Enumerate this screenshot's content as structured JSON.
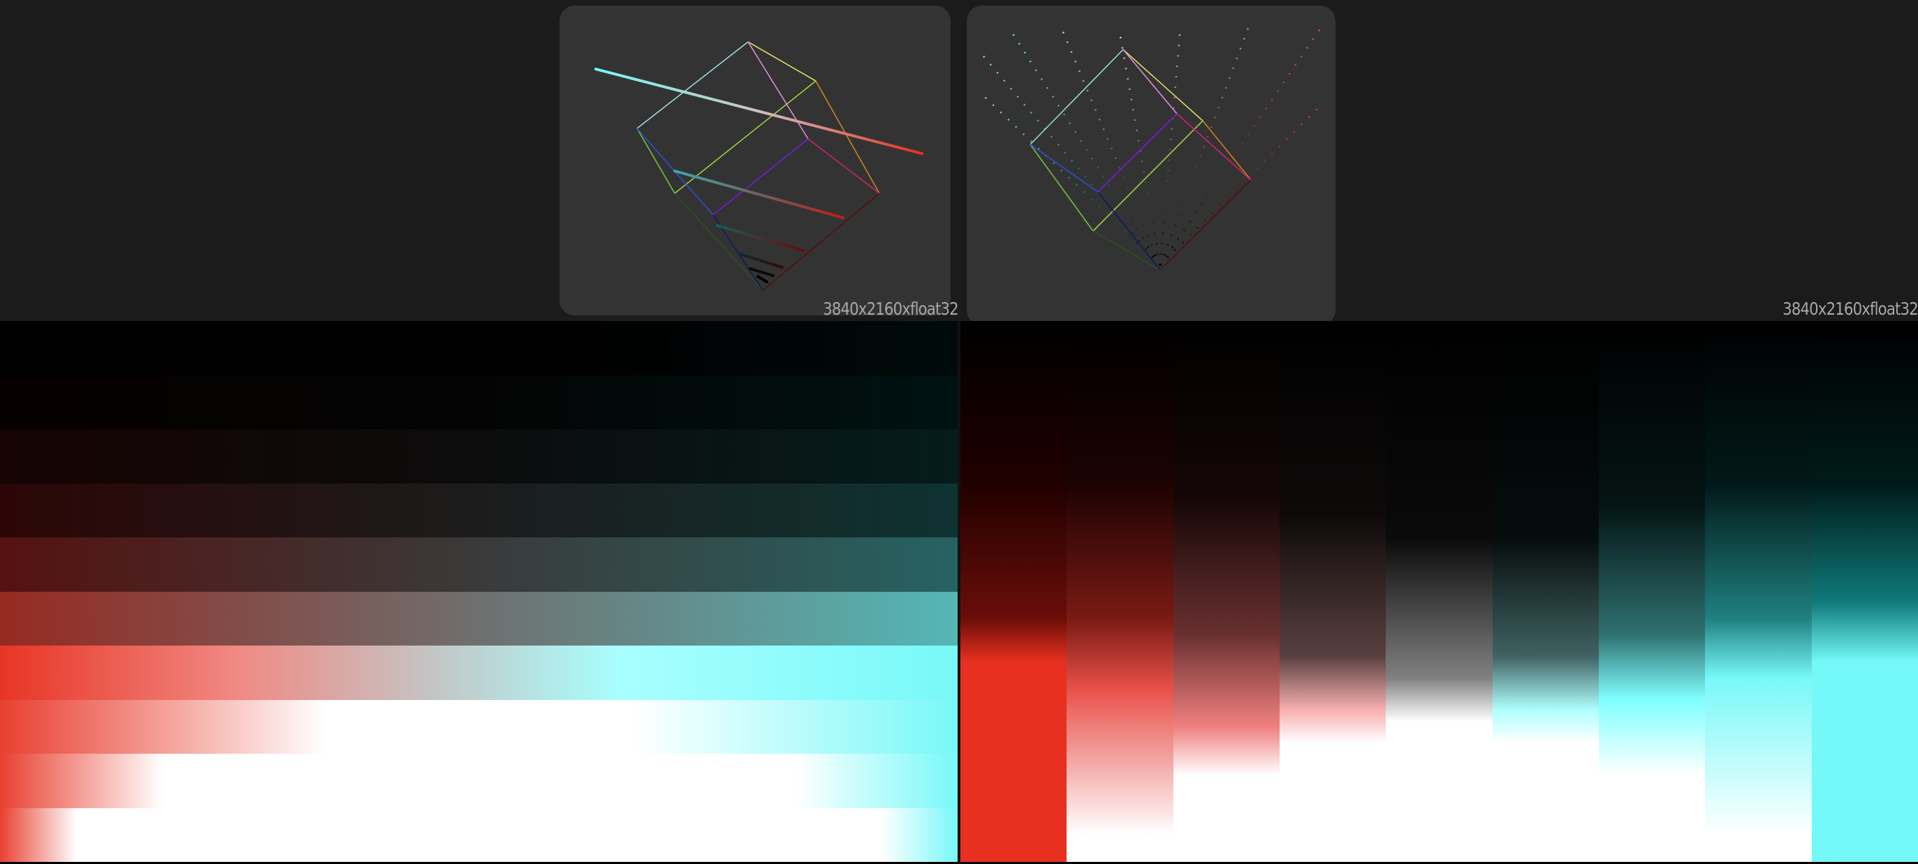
{
  "viewer": {
    "left_view": {
      "label": "3840x2160xfloat32"
    },
    "right_view": {
      "label": "3840x2160xfloat32"
    }
  },
  "colors": {
    "red": "#e83020",
    "cyan": "#74f8f8",
    "background": "#1b1b1b",
    "panel": "#333333"
  }
}
